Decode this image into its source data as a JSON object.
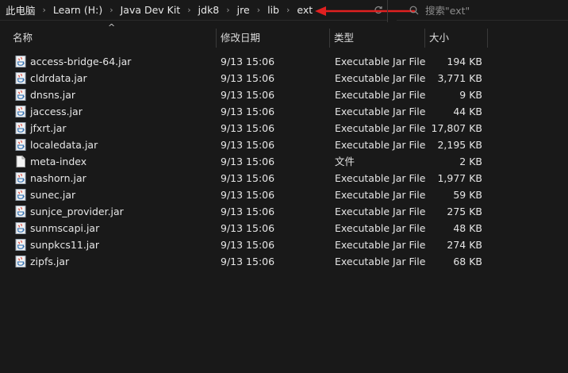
{
  "breadcrumb": [
    "此电脑",
    "Learn (H:)",
    "Java Dev Kit",
    "jdk8",
    "jre",
    "lib",
    "ext"
  ],
  "search": {
    "placeholder": "搜索\"ext\""
  },
  "columns": {
    "name": "名称",
    "date": "修改日期",
    "type": "类型",
    "size": "大小"
  },
  "files": [
    {
      "name": "access-bridge-64.jar",
      "date": "9/13 15:06",
      "type": "Executable Jar File",
      "size": "194 KB",
      "icon": "jar-file-icon"
    },
    {
      "name": "cldrdata.jar",
      "date": "9/13 15:06",
      "type": "Executable Jar File",
      "size": "3,771 KB",
      "icon": "jar-file-icon"
    },
    {
      "name": "dnsns.jar",
      "date": "9/13 15:06",
      "type": "Executable Jar File",
      "size": "9 KB",
      "icon": "jar-file-icon"
    },
    {
      "name": "jaccess.jar",
      "date": "9/13 15:06",
      "type": "Executable Jar File",
      "size": "44 KB",
      "icon": "jar-file-icon"
    },
    {
      "name": "jfxrt.jar",
      "date": "9/13 15:06",
      "type": "Executable Jar File",
      "size": "17,807 KB",
      "icon": "jar-file-icon"
    },
    {
      "name": "localedata.jar",
      "date": "9/13 15:06",
      "type": "Executable Jar File",
      "size": "2,195 KB",
      "icon": "jar-file-icon"
    },
    {
      "name": "meta-index",
      "date": "9/13 15:06",
      "type": "文件",
      "size": "2 KB",
      "icon": "file-icon"
    },
    {
      "name": "nashorn.jar",
      "date": "9/13 15:06",
      "type": "Executable Jar File",
      "size": "1,977 KB",
      "icon": "jar-file-icon"
    },
    {
      "name": "sunec.jar",
      "date": "9/13 15:06",
      "type": "Executable Jar File",
      "size": "59 KB",
      "icon": "jar-file-icon"
    },
    {
      "name": "sunjce_provider.jar",
      "date": "9/13 15:06",
      "type": "Executable Jar File",
      "size": "275 KB",
      "icon": "jar-file-icon"
    },
    {
      "name": "sunmscapi.jar",
      "date": "9/13 15:06",
      "type": "Executable Jar File",
      "size": "48 KB",
      "icon": "jar-file-icon"
    },
    {
      "name": "sunpkcs11.jar",
      "date": "9/13 15:06",
      "type": "Executable Jar File",
      "size": "274 KB",
      "icon": "jar-file-icon"
    },
    {
      "name": "zipfs.jar",
      "date": "9/13 15:06",
      "type": "Executable Jar File",
      "size": "68 KB",
      "icon": "jar-file-icon"
    }
  ],
  "colors": {
    "background": "#191919",
    "text": "#e6e6e6",
    "annotation_arrow": "#e02020"
  }
}
